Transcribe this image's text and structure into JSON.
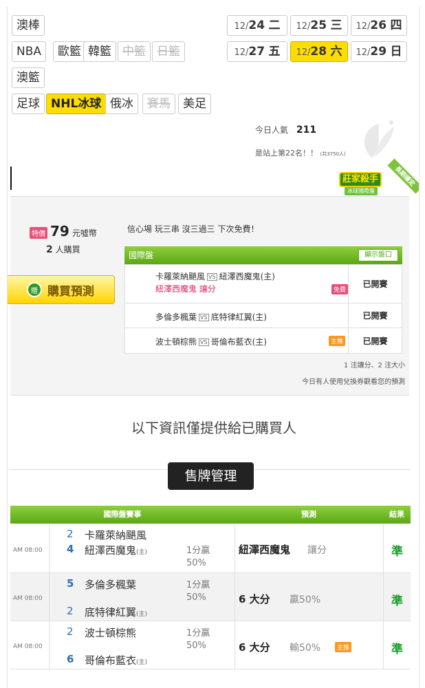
{
  "leagues": {
    "row1": [
      {
        "label": "澳棒",
        "state": "normal"
      }
    ],
    "row2": [
      {
        "label": "NBA",
        "state": "normal"
      },
      {
        "label": "歐籃",
        "state": "normal"
      },
      {
        "label": "韓籃",
        "state": "normal"
      },
      {
        "label": "中籃",
        "state": "disabled"
      },
      {
        "label": "日籃",
        "state": "disabled"
      }
    ],
    "row3": [
      {
        "label": "澳籃",
        "state": "normal"
      }
    ],
    "row4": [
      {
        "label": "足球",
        "state": "normal"
      },
      {
        "label": "NHL冰球",
        "state": "selected"
      },
      {
        "label": "俄冰",
        "state": "normal"
      },
      {
        "label": "賽馬",
        "state": "disabled"
      },
      {
        "label": "美足",
        "state": "normal"
      }
    ]
  },
  "dates": [
    {
      "month": "12/",
      "day": "24",
      "dow": "二",
      "selected": false
    },
    {
      "month": "12/",
      "day": "25",
      "dow": "三",
      "selected": false
    },
    {
      "month": "12/",
      "day": "26",
      "dow": "四",
      "selected": false
    },
    {
      "month": "12/",
      "day": "27",
      "dow": "五",
      "selected": false
    },
    {
      "month": "12/",
      "day": "28",
      "dow": "六",
      "selected": true
    },
    {
      "month": "12/",
      "day": "29",
      "dow": "日",
      "selected": false
    }
  ],
  "popularity": {
    "label": "今日人氣",
    "value": "211",
    "rank_text": "是站上第22名！！",
    "rank_sub": "(共3750人)"
  },
  "badge": {
    "title": "莊家殺手",
    "sub": "冰球國際盤",
    "ribbon": "長期穩定"
  },
  "offer": {
    "special_tag": "特價",
    "price": "79",
    "currency": "元噓幣",
    "buyers_count": "2",
    "buyers_label": "人購買",
    "buy_button": "購買預測",
    "buy_icon": "贈",
    "promo": "信心場 玩三串 沒三過三 下次免費！",
    "table_title": "國際盤",
    "show_odds_button": "顯示盤口",
    "matches": [
      {
        "away": "卡羅萊納颶風",
        "home": "紐澤西魔鬼(主)",
        "pick": "紐澤西魔鬼 讓分",
        "tag": "免費",
        "status": "已開賽"
      },
      {
        "away": "多倫多楓葉",
        "home": "底特律紅翼(主)",
        "pick": "",
        "tag": "",
        "status": "已開賽"
      },
      {
        "away": "波士頓棕熊",
        "home": "哥倫布藍衣(主)",
        "pick": "",
        "tag": "主推",
        "status": "已開賽"
      }
    ],
    "summary": "1 注讓分、2 注大小",
    "note": "今日有人使用兌換券觀看您的預測"
  },
  "info_text": "以下資訊僅提供給已購買人",
  "manage_button": "售牌管理",
  "results": {
    "headers": {
      "event": "國際盤賽事",
      "prediction": "預測",
      "result": "結果"
    },
    "vs_label": "VS",
    "home_mark": "(主)",
    "rows": [
      {
        "time": "AM 08:00",
        "away_score": "2",
        "away": "卡羅萊納颶風",
        "home_score": "4",
        "home": "紐澤西魔鬼",
        "line1": "1分贏",
        "line2": "50%",
        "pred_main": "紐澤西魔鬼",
        "pred_sub": "讓分",
        "pred_tag": "",
        "result": "準"
      },
      {
        "time": "AM 08:00",
        "away_score": "5",
        "away": "多倫多楓葉",
        "home_score": "2",
        "home": "底特律紅翼",
        "line1": "1分贏",
        "line2": "50%",
        "pred_main": "6 大分",
        "pred_sub": "贏50%",
        "pred_tag": "",
        "result": "準"
      },
      {
        "time": "AM 08:00",
        "away_score": "2",
        "away": "波士頓棕熊",
        "home_score": "6",
        "home": "哥倫布藍衣",
        "line1": "1分贏",
        "line2": "50%",
        "pred_main": "6 大分",
        "pred_sub": "輸50%",
        "pred_tag": "主推",
        "result": "準"
      }
    ]
  }
}
